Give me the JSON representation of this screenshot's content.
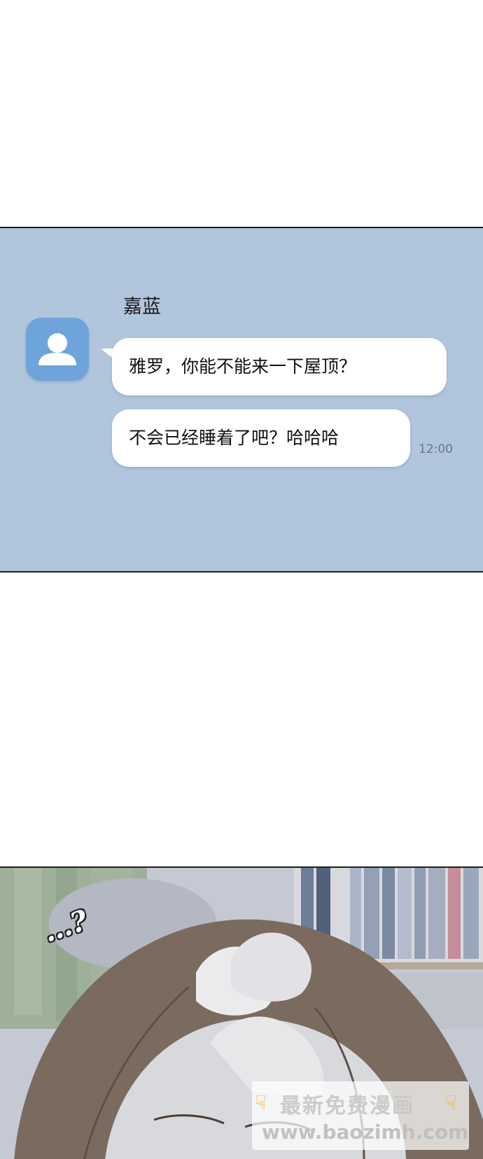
{
  "chat": {
    "sender": "嘉蓝",
    "messages": [
      {
        "text": "雅罗，你能不能来一下屋顶？"
      },
      {
        "text": "不会已经睡着了吧？哈哈哈"
      }
    ],
    "timestamp": "12:00",
    "avatar_icon": "user-icon",
    "colors": {
      "panel": "#b1c6dc",
      "avatar": "#6fa3db",
      "bubble": "#ffffff"
    }
  },
  "art_panel": {
    "sfx_text": "…?"
  },
  "watermark": {
    "title": "最新免费漫画",
    "url": "www.baozimh.com",
    "left_icon": "pointing-hand-icon",
    "right_icon": "pointing-hand-icon"
  }
}
